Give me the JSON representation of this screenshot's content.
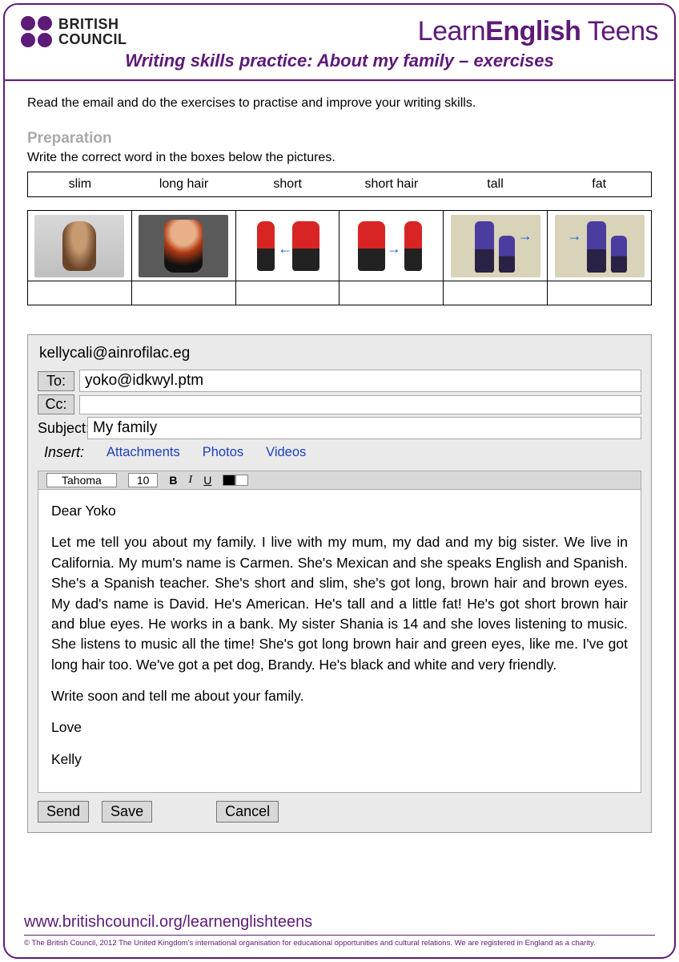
{
  "header": {
    "bc_line1": "BRITISH",
    "bc_line2": "COUNCIL",
    "brand_prefix": "Learn",
    "brand_strong": "English",
    "brand_suffix": " Teens",
    "title": "Writing skills practice: About my family – exercises"
  },
  "intro": "Read the email and do the exercises to practise and improve your writing skills.",
  "preparation": {
    "heading": "Preparation",
    "instruction": "Write the correct word in the boxes below the pictures.",
    "wordbank": [
      "slim",
      "long hair",
      "short",
      "short hair",
      "tall",
      "fat"
    ],
    "answers": [
      "",
      "",
      "",
      "",
      "",
      ""
    ]
  },
  "email": {
    "from": "kellycali@ainrofilac.eg",
    "to_label": "To:",
    "to": "yoko@idkwyl.ptm",
    "cc_label": "Cc:",
    "cc": "",
    "subject_label": "Subject:",
    "subject": "My family",
    "insert_label": "Insert:",
    "insert_links": [
      "Attachments",
      "Photos",
      "Videos"
    ],
    "toolbar": {
      "font": "Tahoma",
      "size": "10",
      "bold": "B",
      "italic": "I",
      "underline": "U"
    },
    "body": {
      "greeting": "Dear Yoko",
      "p1": "Let me tell you about my family. I live with my mum, my dad and my big sister. We live in California. My mum's name is Carmen. She's Mexican and she speaks English and Spanish. She's a Spanish teacher. She's short and slim, she's got long, brown hair and brown eyes. My dad's name is David. He's American. He's tall and a little fat! He's got short brown hair and blue eyes. He works in a bank. My sister Shania is 14 and she loves listening to music. She listens to music all the time! She's got long brown hair and green eyes, like me. I've got long hair too. We've got a pet dog, Brandy. He's black and white and very friendly.",
      "p2": "Write soon and tell me about your family.",
      "sign1": "Love",
      "sign2": "Kelly"
    },
    "buttons": {
      "send": "Send",
      "save": "Save",
      "cancel": "Cancel"
    }
  },
  "footer": {
    "url": "www.britishcouncil.org/learnenglishteens",
    "copyright": "© The British Council, 2012 The United Kingdom's international organisation for educational opportunities and cultural relations. We are registered in England as a charity."
  }
}
